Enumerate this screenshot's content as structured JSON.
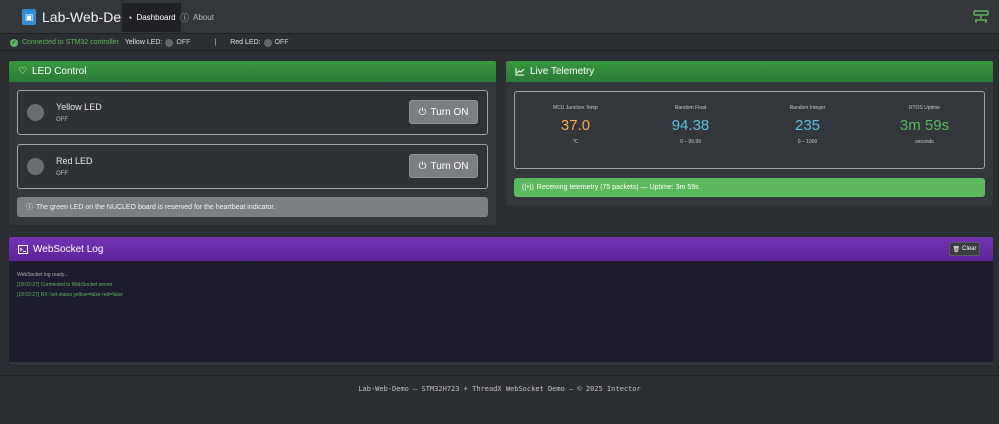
{
  "app": {
    "title": "Lab-Web-Demo",
    "logo_glyph": "[o]"
  },
  "nav": {
    "tabs": [
      {
        "label": "Dashboard",
        "icon": "gauge-icon",
        "glyph": "◔"
      },
      {
        "label": "About",
        "icon": "info-icon",
        "glyph": "ⓘ"
      }
    ],
    "right_icon": "network-icon"
  },
  "status": {
    "connection_glyph": "✓",
    "connection_text": "Connected to STM32 controller",
    "yellow_label": "Yellow LED:",
    "yellow_value": "OFF",
    "separator": "|",
    "red_label": "Red LED:",
    "red_value": "OFF"
  },
  "led_control": {
    "title": "LED Control",
    "icon_glyph": "♡",
    "leds": [
      {
        "name": "Yellow LED",
        "state": "OFF",
        "button": "Turn ON",
        "button_glyph": "⏻"
      },
      {
        "name": "Red LED",
        "state": "OFF",
        "button": "Turn ON",
        "button_glyph": "⏻"
      }
    ],
    "info_glyph": "ⓘ",
    "info": "The green LED on the NUCLEO board is reserved for the heartbeat indicator."
  },
  "telemetry": {
    "title": "Live Telemetry",
    "icon_glyph": "📈",
    "metrics": [
      {
        "label": "MCU Junction Temp",
        "value": "37.0",
        "unit": "°C",
        "color": "#f0ad4e"
      },
      {
        "label": "Random Float",
        "value": "94.38",
        "unit": "0 – 99.99",
        "color": "#5bc0de"
      },
      {
        "label": "Random Integer",
        "value": "235",
        "unit": "0 – 1000",
        "color": "#5bc0de"
      },
      {
        "label": "RTOS Uptime",
        "value": "3m 59s",
        "unit": "seconds",
        "color": "#5cb85c"
      }
    ],
    "status_glyph": "((•))",
    "status_text": "Receiving telemetry (75 packets) — Uptime: 3m 59s"
  },
  "websocket_log": {
    "title": "WebSocket Log",
    "icon_glyph": ">_",
    "clear_label": "Clear",
    "clear_glyph": "🗑",
    "lines": [
      {
        "text": "WebSocket log ready...",
        "type": "info"
      },
      {
        "text": "[18:02:27] Connected to WebSocket server",
        "type": "ok"
      },
      {
        "text": "[18:02:27] RX: led-status yellow=false red=false",
        "type": "ok"
      }
    ]
  },
  "footer": {
    "text": "Lab-Web-Demo — STM32H723 + ThreadX WebSocket Demo — © 2025 Intector"
  },
  "colors": {
    "accent_green": "#2f8a3e",
    "accent_purple": "#6a2aa8",
    "success": "#5cb85c"
  }
}
